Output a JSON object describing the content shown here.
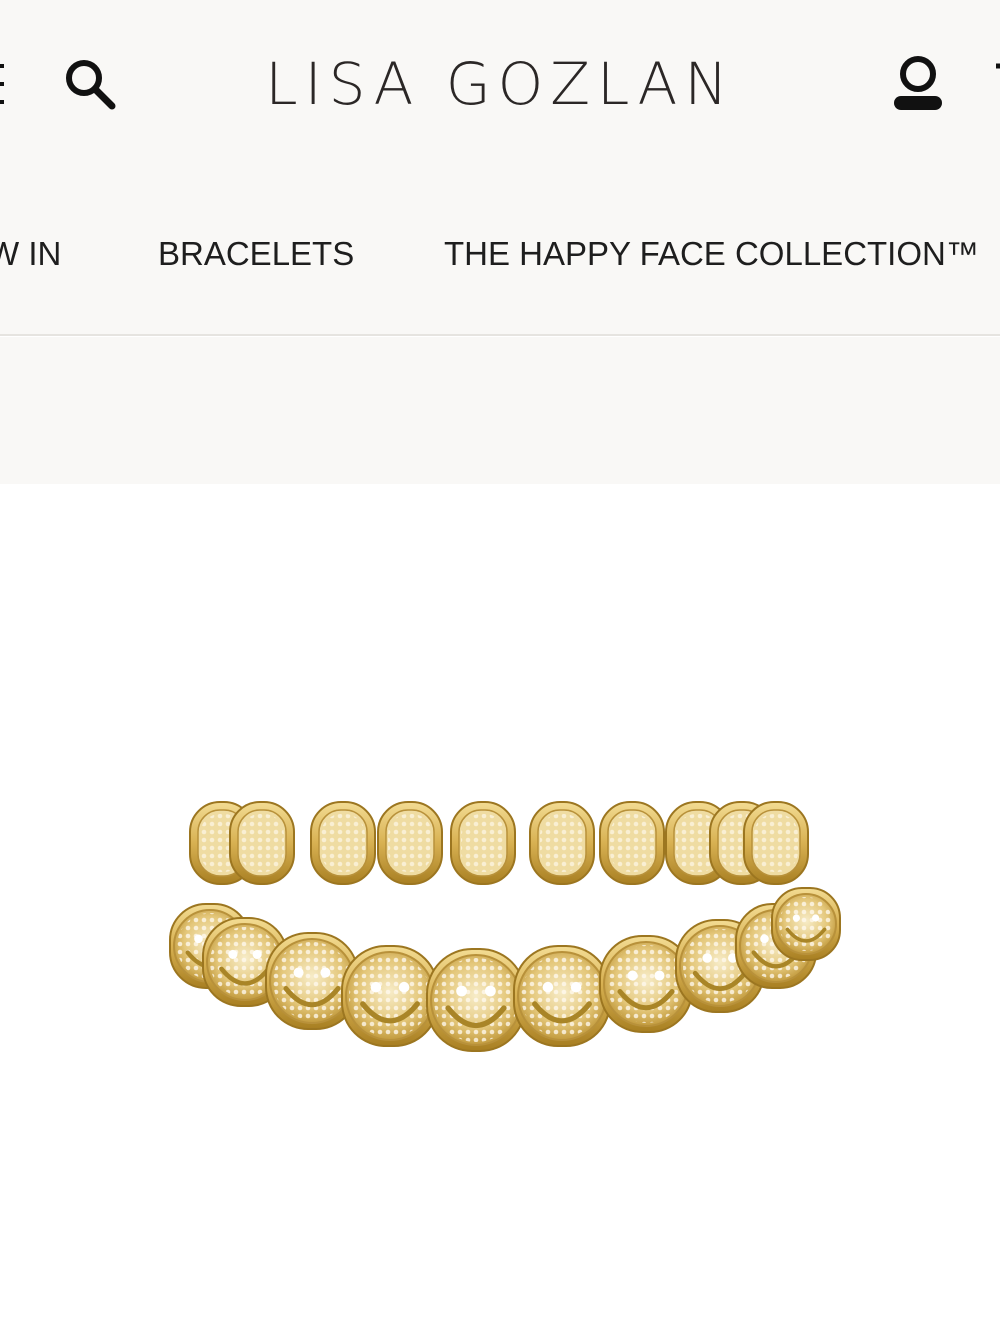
{
  "header": {
    "brand": "LISA GOZLAN",
    "icons": [
      "menu-icon",
      "search-icon",
      "account-icon",
      "cart-icon"
    ]
  },
  "nav": {
    "items": [
      {
        "label": "W IN"
      },
      {
        "label": "BRACELETS"
      },
      {
        "label": "THE HAPPY FACE COLLECTION™"
      }
    ]
  },
  "product": {
    "image": "gold-happy-face-bracelet"
  },
  "colors": {
    "header_bg": "#f9f8f6",
    "text": "#1e1e1e",
    "gold": "#d9b85a"
  }
}
